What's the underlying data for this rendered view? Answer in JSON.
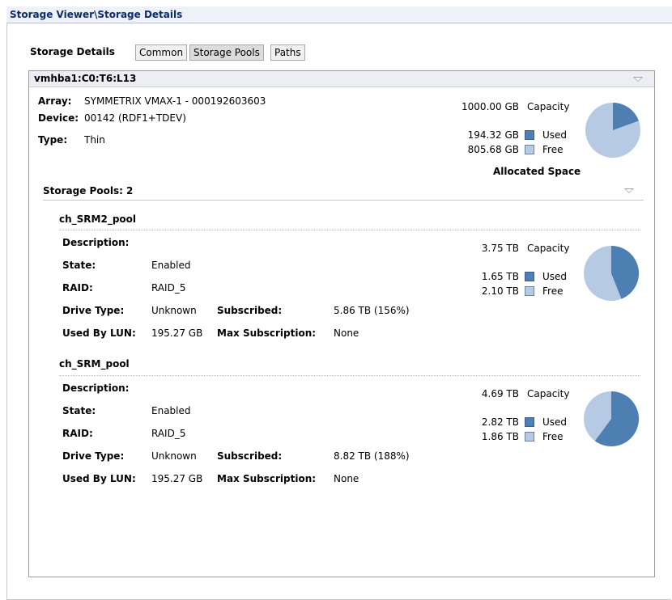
{
  "header": {
    "title": "Storage Viewer\\Storage Details"
  },
  "section": {
    "label": "Storage Details"
  },
  "tabs": [
    {
      "label": "Common"
    },
    {
      "label": "Storage Pools"
    },
    {
      "label": "Paths"
    }
  ],
  "device_panel": {
    "title": "vmhba1:C0:T6:L13",
    "array_label": "Array:",
    "array_value": "SYMMETRIX VMAX-1 - 000192603603",
    "device_label": "Device:",
    "device_value": "00142 (RDF1+TDEV)",
    "type_label": "Type:",
    "type_value": "Thin",
    "capacity_value": "1000.00 GB",
    "capacity_label": "Capacity",
    "used_value": "194.32 GB",
    "used_label": "Used",
    "free_value": "805.68 GB",
    "free_label": "Free",
    "allocated_label": "Allocated Space",
    "used_fraction": 0.1943
  },
  "pools": {
    "heading": "Storage Pools: 2",
    "items": [
      {
        "name": "ch_SRM2_pool",
        "description_label": "Description:",
        "state_label": "State:",
        "state_value": "Enabled",
        "raid_label": "RAID:",
        "raid_value": "RAID_5",
        "drive_type_label": "Drive Type:",
        "drive_type_value": "Unknown",
        "subscribed_label": "Subscribed:",
        "subscribed_value": "5.86 TB (156%)",
        "used_by_lun_label": "Used By LUN:",
        "used_by_lun_value": "195.27 GB",
        "max_subscription_label": "Max Subscription:",
        "max_subscription_value": "None",
        "capacity_value": "3.75 TB",
        "capacity_label": "Capacity",
        "used_value": "1.65 TB",
        "used_label": "Used",
        "free_value": "2.10 TB",
        "free_label": "Free",
        "used_fraction": 0.44
      },
      {
        "name": "ch_SRM_pool",
        "description_label": "Description:",
        "state_label": "State:",
        "state_value": "Enabled",
        "raid_label": "RAID:",
        "raid_value": "RAID_5",
        "drive_type_label": "Drive Type:",
        "drive_type_value": "Unknown",
        "subscribed_label": "Subscribed:",
        "subscribed_value": "8.82 TB (188%)",
        "used_by_lun_label": "Used By LUN:",
        "used_by_lun_value": "195.27 GB",
        "max_subscription_label": "Max Subscription:",
        "max_subscription_value": "None",
        "capacity_value": "4.69 TB",
        "capacity_label": "Capacity",
        "used_value": "2.82 TB",
        "used_label": "Used",
        "free_value": "1.86 TB",
        "free_label": "Free",
        "used_fraction": 0.6013
      }
    ]
  },
  "colors": {
    "used": "#4e7fb3",
    "free": "#b6cae3",
    "title": "#0b2d6b"
  }
}
